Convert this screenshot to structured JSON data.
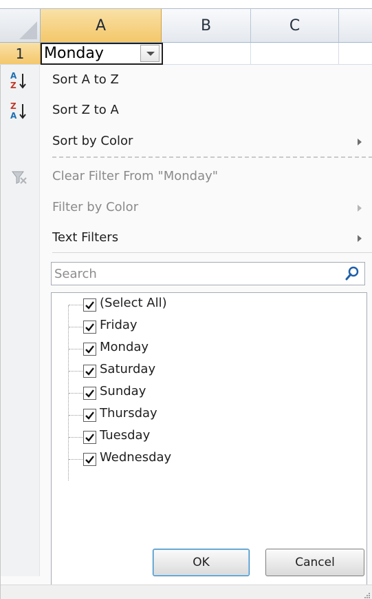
{
  "sheet": {
    "columns": [
      "A",
      "B",
      "C"
    ],
    "row_number": "1",
    "cell_a1_value": "Monday"
  },
  "menu": {
    "sort_az": "Sort A to Z",
    "sort_za": "Sort Z to A",
    "sort_by_color": "Sort by Color",
    "clear_filter": "Clear Filter From \"Monday\"",
    "filter_by_color": "Filter by Color",
    "text_filters": "Text Filters"
  },
  "search": {
    "placeholder": "Search",
    "value": ""
  },
  "list": {
    "items": [
      {
        "label": "(Select All)",
        "checked": true
      },
      {
        "label": "Friday",
        "checked": true
      },
      {
        "label": "Monday",
        "checked": true
      },
      {
        "label": "Saturday",
        "checked": true
      },
      {
        "label": "Sunday",
        "checked": true
      },
      {
        "label": "Thursday",
        "checked": true
      },
      {
        "label": "Tuesday",
        "checked": true
      },
      {
        "label": "Wednesday",
        "checked": true
      }
    ]
  },
  "buttons": {
    "ok": "OK",
    "cancel": "Cancel"
  },
  "icons": {
    "sort_az": "sort-ascending-icon",
    "sort_za": "sort-descending-icon",
    "clear_filter": "clear-filter-icon",
    "search": "search-icon",
    "dropdown": "filter-dropdown-icon"
  },
  "colors": {
    "selected_header": "#f4c76a",
    "accent_blue": "#1f6fb2",
    "sort_red": "#c0392b",
    "disabled_text": "#8a8a8a"
  }
}
